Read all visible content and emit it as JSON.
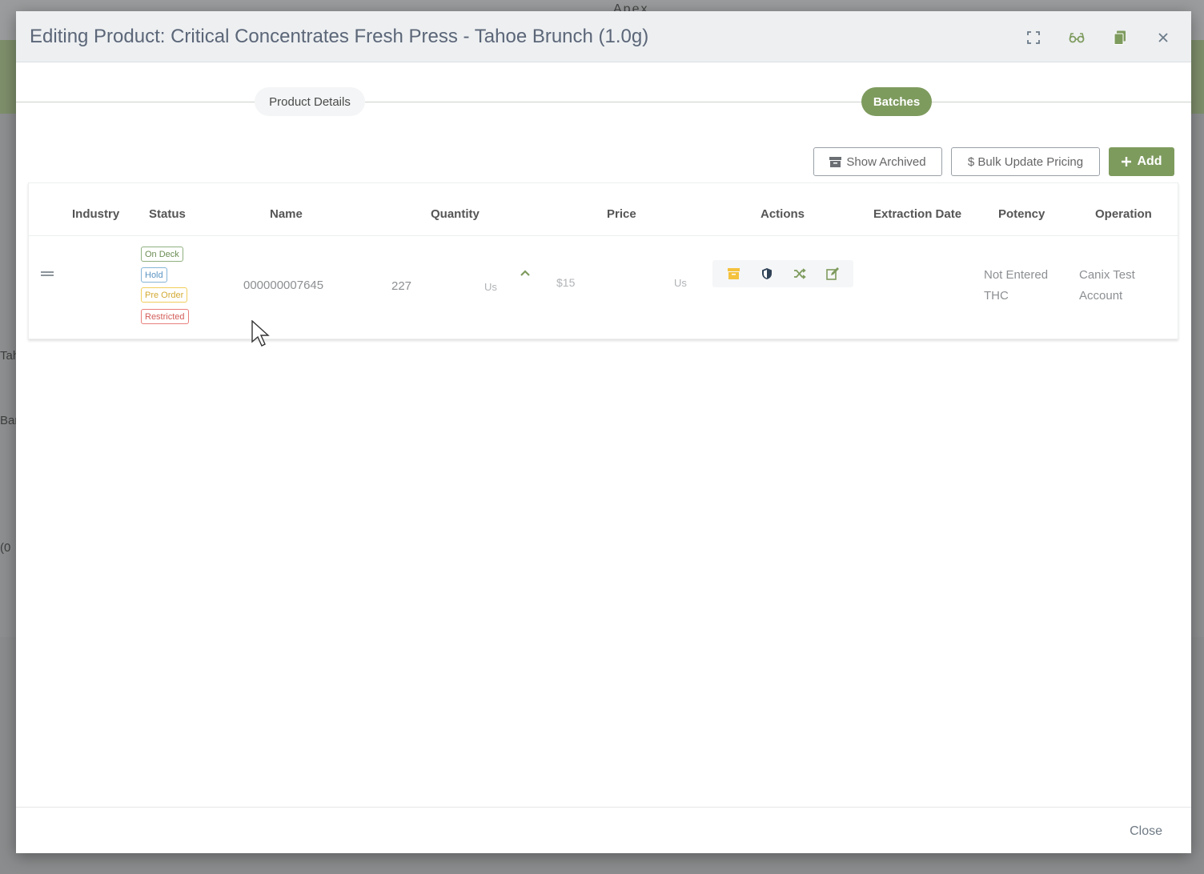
{
  "backdrop": {
    "title": "Apex",
    "left_fragments": [
      "Tah",
      "Ban",
      "(0"
    ]
  },
  "modal": {
    "title": "Editing Product: Critical Concentrates Fresh Press - Tahoe Brunch (1.0g)",
    "icons": [
      "expand-icon",
      "glasses-icon",
      "copy-icon",
      "close-icon"
    ]
  },
  "steps": {
    "details_label": "Product Details",
    "batches_label": "Batches",
    "active": "Batches"
  },
  "toolbar": {
    "show_archived_label": "Show Archived",
    "bulk_update_label": "$ Bulk Update Pricing",
    "add_label": "Add"
  },
  "table": {
    "headers": {
      "industry": "Industry",
      "status": "Status",
      "name": "Name",
      "quantity": "Quantity",
      "price": "Price",
      "actions": "Actions",
      "extraction_date": "Extraction Date",
      "potency": "Potency",
      "operation": "Operation"
    },
    "row": {
      "tags": {
        "on_deck": "On Deck",
        "hold": "Hold",
        "pre_order": "Pre Order",
        "restricted": "Restricted"
      },
      "name": "000000007645",
      "quantity": "227",
      "quantity_unit": "Us",
      "price": "$15",
      "price_unit": "Us",
      "potency_line1": "Not Entered",
      "potency_line2": "THC",
      "operation_line1": "Canix Test",
      "operation_line2": "Account"
    }
  },
  "footer": {
    "close_label": "Close"
  },
  "colors": {
    "accent_green": "#7e9b5e",
    "archive_yellow": "#f4c23d",
    "shield_navy": "#2f4256"
  }
}
